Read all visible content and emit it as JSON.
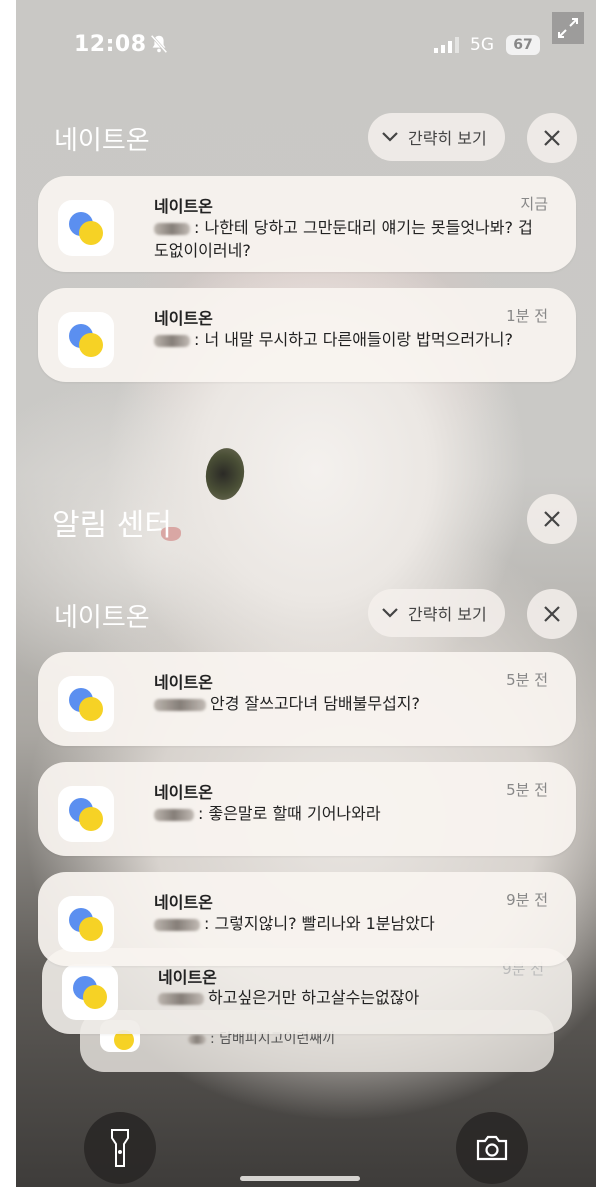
{
  "status_bar": {
    "time": "12:08",
    "network": "5G",
    "battery": "67"
  },
  "groups": [
    {
      "app_label": "네이트온",
      "brief_label": "간략히 보기"
    },
    {
      "app_label": "네이트온",
      "brief_label": "간략히 보기"
    }
  ],
  "notification_center": {
    "title": "알림 센터"
  },
  "notifications": [
    {
      "app": "네이트온",
      "time": "지금",
      "message": ": 나한테 당하고 그만둔대리 얘기는 못들엇나봐? 겁도없이이러네?"
    },
    {
      "app": "네이트온",
      "time": "1분 전",
      "message": ": 너 내말 무시하고 다른애들이랑 밥먹으러가니?"
    },
    {
      "app": "네이트온",
      "time": "5분 전",
      "message": "안경 잘쓰고다녀 담배불무섭지?"
    },
    {
      "app": "네이트온",
      "time": "5분 전",
      "message": ": 좋은말로 할때 기어나와라"
    },
    {
      "app": "네이트온",
      "time": "9분 전",
      "message": ": 그렇지않니? 빨리나와 1분남았다"
    },
    {
      "app": "네이트온",
      "time": "9분 전",
      "message": "하고싶은거만 하고살수는없잖아"
    },
    {
      "app": "",
      "time": "",
      "message": ": 담배피지고이런쌔끼"
    }
  ],
  "icons": {
    "app_icon_colors": {
      "blue": "#5b8ff0",
      "yellow": "#f6d225"
    },
    "bottom_left": "flashlight-icon",
    "bottom_right": "camera-icon"
  }
}
